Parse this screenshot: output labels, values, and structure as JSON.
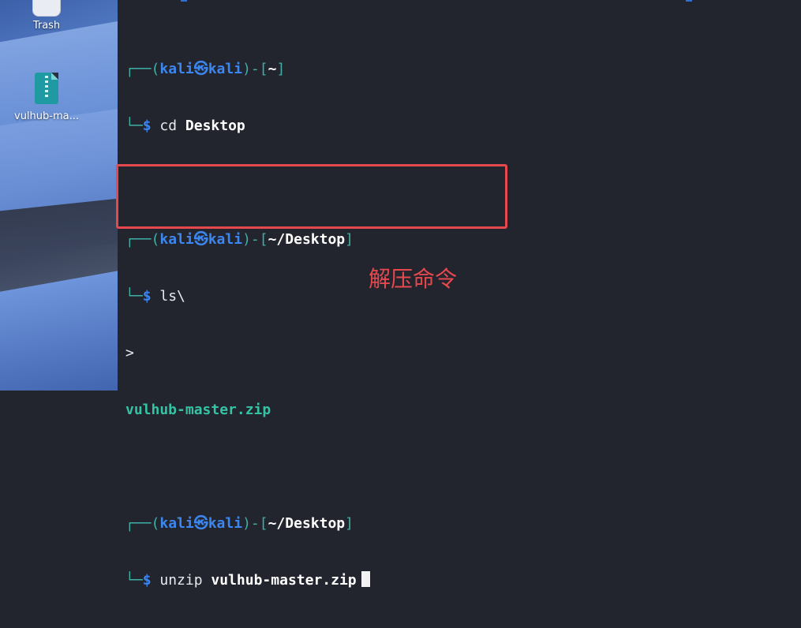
{
  "desktop": {
    "icons": [
      {
        "label": "Trash",
        "icon": "trash-icon"
      },
      {
        "label": "vulhub-ma...",
        "icon": "zip-file-icon"
      }
    ]
  },
  "terminal": {
    "prompt_user": "kali",
    "prompt_separator": "㉿",
    "prompt_host": "kali",
    "blocks": [
      {
        "path": "~",
        "command": "cd",
        "argument": "Desktop"
      },
      {
        "path": "~/Desktop",
        "command": "ls\\",
        "argument": ""
      },
      {
        "continuation": ">",
        "output": "vulhub-master.zip"
      },
      {
        "path": "~/Desktop",
        "command": "unzip",
        "argument": "vulhub-master.zip"
      }
    ]
  },
  "annotation": {
    "text": "解压命令",
    "color": "#e5484d"
  },
  "colors": {
    "terminal_bg": "#23252e",
    "prompt_blue": "#3c86f0",
    "file_teal": "#34c3a4",
    "highlight_red": "#e5484d"
  }
}
